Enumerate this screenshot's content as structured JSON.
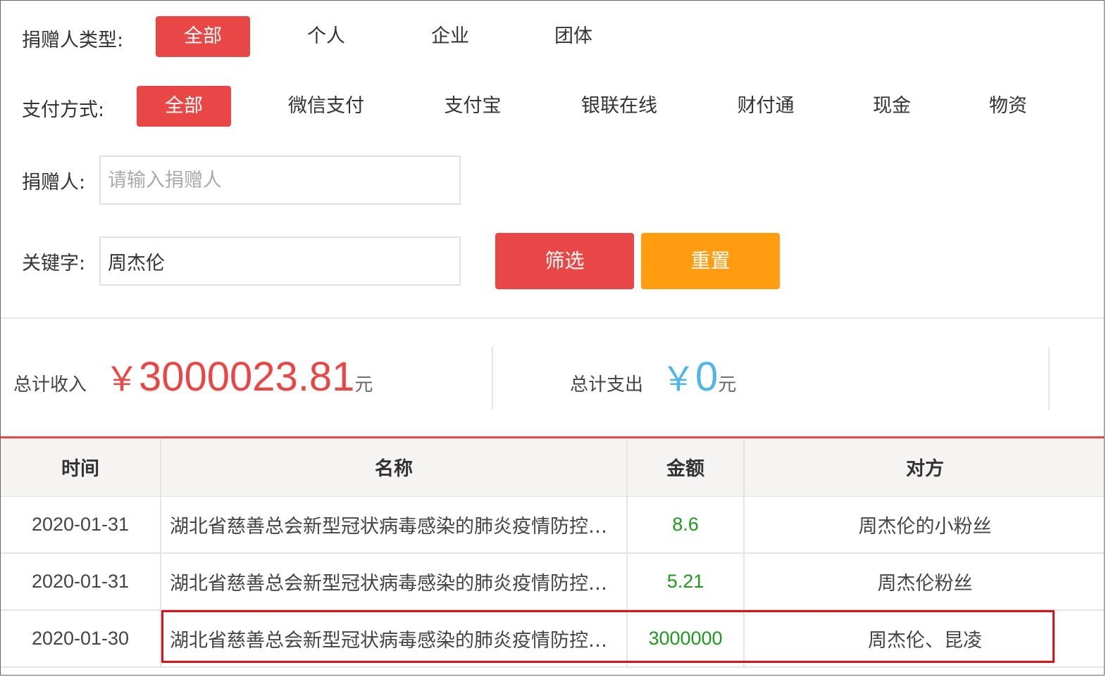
{
  "filters": {
    "donor_type": {
      "label": "捐赠人类型:",
      "options": [
        "全部",
        "个人",
        "企业",
        "团体"
      ],
      "selected": "全部"
    },
    "payment": {
      "label": "支付方式:",
      "options": [
        "全部",
        "微信支付",
        "支付宝",
        "银联在线",
        "财付通",
        "现金",
        "物资"
      ],
      "selected": "全部"
    },
    "donor": {
      "label": "捐赠人:",
      "value": "",
      "placeholder": "请输入捐赠人"
    },
    "keyword": {
      "label": "关键字:",
      "value": "周杰伦",
      "placeholder": ""
    },
    "filter_button": "筛选",
    "reset_button": "重置"
  },
  "totals": {
    "income": {
      "label": "总计收入",
      "currency": "￥",
      "amount": "3000023.81",
      "unit": "元"
    },
    "expense": {
      "label": "总计支出",
      "currency": "￥",
      "amount": "0",
      "unit": "元"
    }
  },
  "table": {
    "headers": [
      "时间",
      "名称",
      "金额",
      "对方"
    ],
    "rows": [
      {
        "time": "2020-01-31",
        "name": "湖北省慈善总会新型冠状病毒感染的肺炎疫情防控…",
        "amount": "8.6",
        "party": "周杰伦的小粉丝"
      },
      {
        "time": "2020-01-31",
        "name": "湖北省慈善总会新型冠状病毒感染的肺炎疫情防控…",
        "amount": "5.21",
        "party": "周杰伦粉丝"
      },
      {
        "time": "2020-01-30",
        "name": "湖北省慈善总会新型冠状病毒感染的肺炎疫情防控…",
        "amount": "3000000",
        "party": "周杰伦、昆凌"
      }
    ]
  },
  "colors": {
    "accent_red": "#e94646",
    "accent_orange": "#ff9c0f",
    "expense_blue": "#4fb6ec",
    "amount_green": "#1e9b1e",
    "highlight_red": "#e0101a"
  }
}
